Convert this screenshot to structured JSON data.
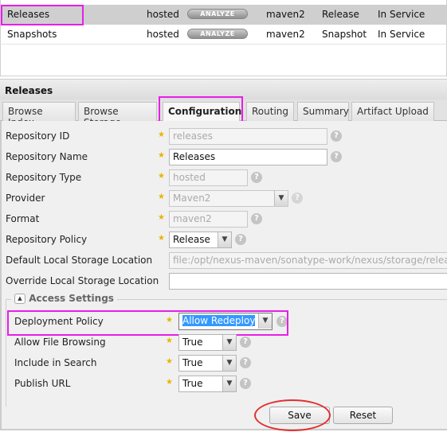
{
  "grid": {
    "rows": [
      {
        "name": "Releases",
        "type": "hosted",
        "analyze": "ANALYZE",
        "format": "maven2",
        "policy": "Release",
        "status": "In Service"
      },
      {
        "name": "Snapshots",
        "type": "hosted",
        "analyze": "ANALYZE",
        "format": "maven2",
        "policy": "Snapshot",
        "status": "In Service"
      }
    ]
  },
  "panel": {
    "title": "Releases"
  },
  "tabs": [
    "Browse Index",
    "Browse Storage",
    "Configuration",
    "Routing",
    "Summary",
    "Artifact Upload"
  ],
  "form": {
    "repo_id": {
      "label": "Repository ID",
      "value": "releases"
    },
    "repo_name": {
      "label": "Repository Name",
      "value": "Releases"
    },
    "repo_type": {
      "label": "Repository Type",
      "value": "hosted"
    },
    "provider": {
      "label": "Provider",
      "value": "Maven2"
    },
    "format": {
      "label": "Format",
      "value": "maven2"
    },
    "policy": {
      "label": "Repository Policy",
      "value": "Release"
    },
    "default_loc": {
      "label": "Default Local Storage Location",
      "value": "file:/opt/nexus-maven/sonatype-work/nexus/storage/releases/"
    },
    "override_loc": {
      "label": "Override Local Storage Location",
      "value": ""
    }
  },
  "access": {
    "title": "Access Settings",
    "deployment": {
      "label": "Deployment Policy",
      "value": "Allow Redeploy"
    },
    "browsing": {
      "label": "Allow File Browsing",
      "value": "True"
    },
    "search": {
      "label": "Include in Search",
      "value": "True"
    },
    "publish": {
      "label": "Publish URL",
      "value": "True"
    }
  },
  "buttons": {
    "save": "Save",
    "reset": "Reset"
  },
  "colors": {
    "highlight": "#e81ee8",
    "annotation_circle": "#e03030",
    "selection": "#3399ff"
  }
}
